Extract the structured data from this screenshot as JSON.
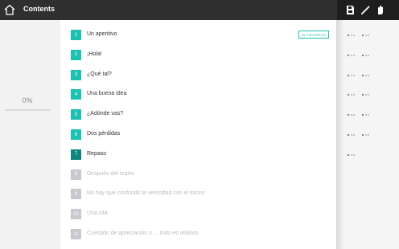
{
  "header": {
    "title": "Contents",
    "icons": [
      "home-icon",
      "save-icon",
      "pen-icon",
      "hand-icon"
    ]
  },
  "progress": {
    "label": "0%",
    "value": 0
  },
  "lessons": [
    {
      "number": "1",
      "title": "Un aperitivo",
      "state": "done",
      "badge": "IN PROGRESS"
    },
    {
      "number": "2",
      "title": "¡Hola!",
      "state": "done"
    },
    {
      "number": "3",
      "title": "¿Qué tal?",
      "state": "done"
    },
    {
      "number": "4",
      "title": "Una buena idea",
      "state": "done"
    },
    {
      "number": "5",
      "title": "¿Adónde vas?",
      "state": "done"
    },
    {
      "number": "6",
      "title": "Dos pérdidas",
      "state": "done"
    },
    {
      "number": "7",
      "title": "Repaso",
      "state": "current"
    },
    {
      "number": "8",
      "title": "Después del teatro",
      "state": "locked"
    },
    {
      "number": "9",
      "title": "No hay que confundir la velocidad con el tocino",
      "state": "locked"
    },
    {
      "number": "10",
      "title": "Una cita",
      "state": "locked"
    },
    {
      "number": "11",
      "title": "Cuestión de apreciación o ... todo es relativo",
      "state": "locked"
    }
  ],
  "colors": {
    "accent": "#1dc1b2",
    "current": "#0f877e",
    "locked": "#c7c9ce",
    "topbar": "#2f2f2f"
  }
}
